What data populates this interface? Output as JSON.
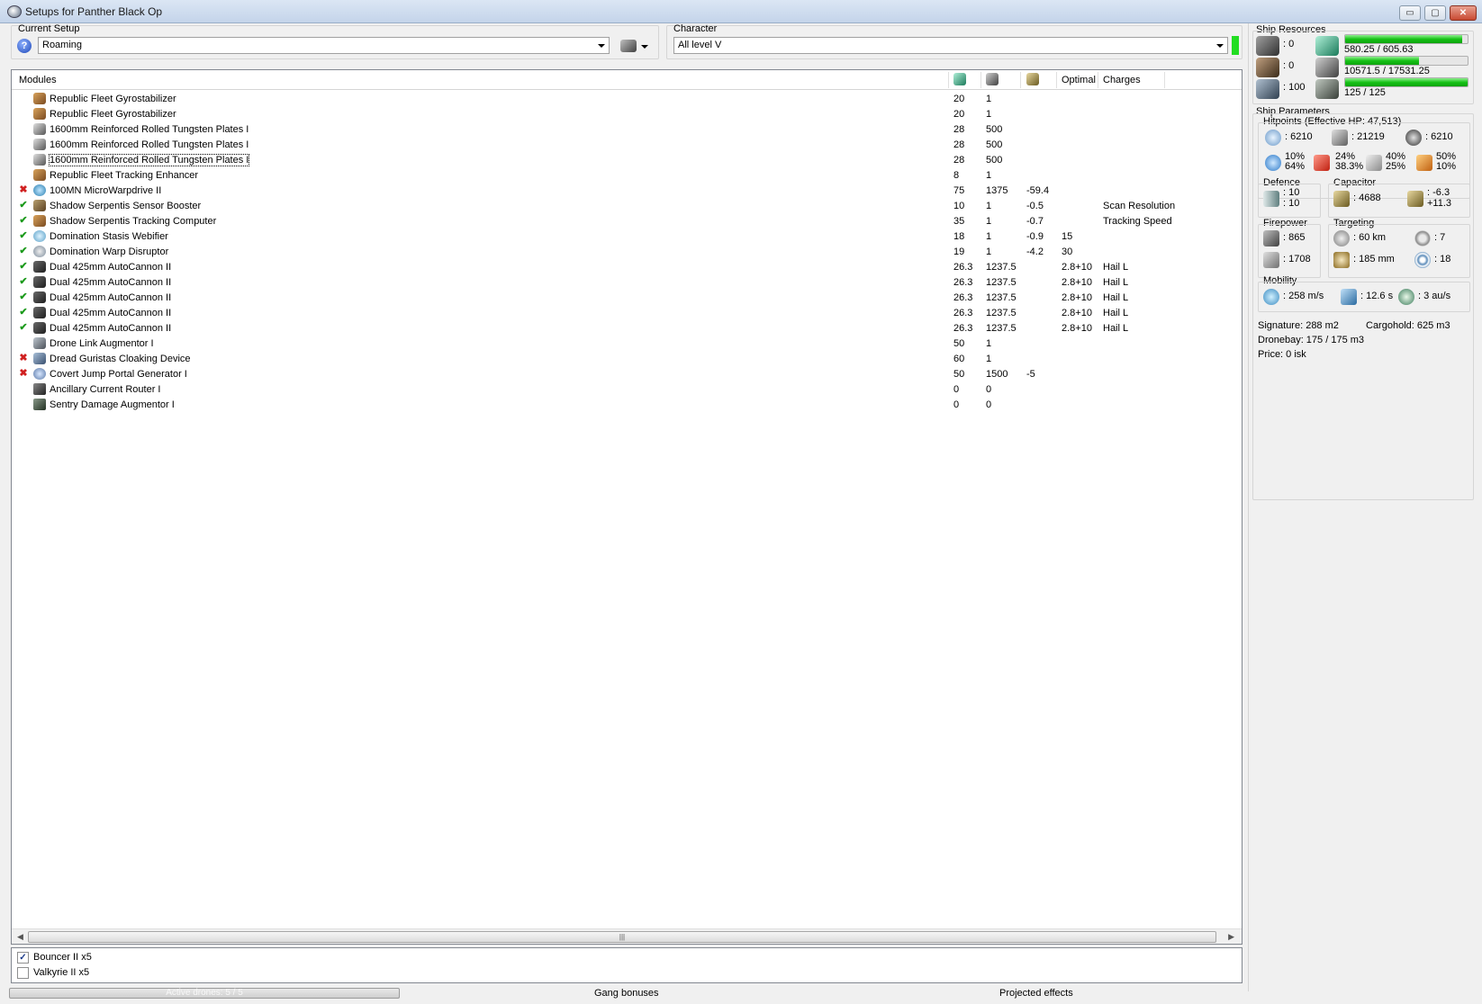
{
  "window": {
    "title": "Setups for Panther Black Op",
    "min_label": "▭",
    "max_label": "▢",
    "close_label": "✕"
  },
  "setup": {
    "label": "Current Setup",
    "value": "Roaming"
  },
  "character": {
    "label": "Character",
    "value": "All level V"
  },
  "grid": {
    "headers": {
      "modules": "Modules",
      "optimal": "Optimal",
      "charges": "Charges"
    },
    "rows": [
      {
        "mark": "",
        "icon": "gyro",
        "name": "Republic Fleet Gyrostabilizer",
        "cpu": "20",
        "pg": "1",
        "cap": "",
        "optimal": "",
        "charges": ""
      },
      {
        "mark": "",
        "icon": "gyro",
        "name": "Republic Fleet Gyrostabilizer",
        "cpu": "20",
        "pg": "1",
        "cap": "",
        "optimal": "",
        "charges": ""
      },
      {
        "mark": "",
        "icon": "plate",
        "name": "1600mm Reinforced Rolled Tungsten Plates I",
        "cpu": "28",
        "pg": "500",
        "cap": "",
        "optimal": "",
        "charges": ""
      },
      {
        "mark": "",
        "icon": "plate",
        "name": "1600mm Reinforced Rolled Tungsten Plates I",
        "cpu": "28",
        "pg": "500",
        "cap": "",
        "optimal": "",
        "charges": ""
      },
      {
        "mark": "",
        "icon": "plate",
        "name": "1600mm Reinforced Rolled Tungsten Plates I",
        "cpu": "28",
        "pg": "500",
        "cap": "",
        "optimal": "",
        "charges": ""
      },
      {
        "mark": "",
        "icon": "gyro",
        "name": "Republic Fleet Tracking Enhancer",
        "cpu": "8",
        "pg": "1",
        "cap": "",
        "optimal": "",
        "charges": ""
      },
      {
        "mark": "✖",
        "icon": "mwd",
        "name": "100MN MicroWarpdrive II",
        "cpu": "75",
        "pg": "1375",
        "cap": "-59.4",
        "optimal": "",
        "charges": ""
      },
      {
        "mark": "✔",
        "icon": "booster",
        "name": "Shadow Serpentis Sensor Booster",
        "cpu": "10",
        "pg": "1",
        "cap": "-0.5",
        "optimal": "",
        "charges": "Scan Resolution"
      },
      {
        "mark": "✔",
        "icon": "gyro",
        "name": "Shadow Serpentis Tracking Computer",
        "cpu": "35",
        "pg": "1",
        "cap": "-0.7",
        "optimal": "",
        "charges": "Tracking Speed"
      },
      {
        "mark": "✔",
        "icon": "web",
        "name": "Domination Stasis Webifier",
        "cpu": "18",
        "pg": "1",
        "cap": "-0.9",
        "optimal": "15",
        "charges": ""
      },
      {
        "mark": "✔",
        "icon": "disruptor",
        "name": "Domination Warp Disruptor",
        "cpu": "19",
        "pg": "1",
        "cap": "-4.2",
        "optimal": "30",
        "charges": ""
      },
      {
        "mark": "✔",
        "icon": "cannon",
        "name": "Dual 425mm AutoCannon II",
        "cpu": "26.3",
        "pg": "1237.5",
        "cap": "",
        "optimal": "2.8+10",
        "charges": "Hail L"
      },
      {
        "mark": "✔",
        "icon": "cannon",
        "name": "Dual 425mm AutoCannon II",
        "cpu": "26.3",
        "pg": "1237.5",
        "cap": "",
        "optimal": "2.8+10",
        "charges": "Hail L"
      },
      {
        "mark": "✔",
        "icon": "cannon",
        "name": "Dual 425mm AutoCannon II",
        "cpu": "26.3",
        "pg": "1237.5",
        "cap": "",
        "optimal": "2.8+10",
        "charges": "Hail L"
      },
      {
        "mark": "✔",
        "icon": "cannon",
        "name": "Dual 425mm AutoCannon II",
        "cpu": "26.3",
        "pg": "1237.5",
        "cap": "",
        "optimal": "2.8+10",
        "charges": "Hail L"
      },
      {
        "mark": "✔",
        "icon": "cannon",
        "name": "Dual 425mm AutoCannon II",
        "cpu": "26.3",
        "pg": "1237.5",
        "cap": "",
        "optimal": "2.8+10",
        "charges": "Hail L"
      },
      {
        "mark": "",
        "icon": "drone-link",
        "name": "Drone Link Augmentor I",
        "cpu": "50",
        "pg": "1",
        "cap": "",
        "optimal": "",
        "charges": ""
      },
      {
        "mark": "✖",
        "icon": "cloak",
        "name": "Dread Guristas Cloaking Device",
        "cpu": "60",
        "pg": "1",
        "cap": "",
        "optimal": "",
        "charges": ""
      },
      {
        "mark": "✖",
        "icon": "portal",
        "name": "Covert Jump Portal Generator I",
        "cpu": "50",
        "pg": "1500",
        "cap": "-5",
        "optimal": "",
        "charges": ""
      },
      {
        "mark": "",
        "icon": "rig1",
        "name": "Ancillary Current Router I",
        "cpu": "0",
        "pg": "0",
        "cap": "",
        "optimal": "",
        "charges": ""
      },
      {
        "mark": "",
        "icon": "rig2",
        "name": "Sentry Damage Augmentor I",
        "cpu": "0",
        "pg": "0",
        "cap": "",
        "optimal": "",
        "charges": ""
      }
    ]
  },
  "drones": [
    {
      "label": "Bouncer II x5",
      "checked": true,
      "check_glyph": "✓"
    },
    {
      "label": "Valkyrie II x5",
      "checked": false,
      "check_glyph": ""
    }
  ],
  "statusbar": {
    "active_drones": "Active drones: 5 / 5",
    "gang": "Gang bonuses",
    "projected": "Projected effects"
  },
  "resources": {
    "title": "Ship Resources",
    "turrets": ": 0",
    "launchers": ": 0",
    "calibration": ": 100",
    "cpu": {
      "text": "580.25 / 605.63",
      "fraction": 0.958
    },
    "powergrid": {
      "text": "10571.5 / 17531.25",
      "fraction": 0.603
    },
    "dronebandwidth": {
      "text": "125 / 125",
      "fraction": 1.0
    }
  },
  "params": {
    "title": "Ship Parameters",
    "hitpoints_title": "Hitpoints (Effective HP: 47,513)",
    "shield_hp": ": 6210",
    "armor_hp": ": 21219",
    "hull_hp": ": 6210",
    "em": {
      "a": "10%",
      "b": "64%"
    },
    "thermal": {
      "a": "24%",
      "b": "38.3%"
    },
    "kinetic": {
      "a": "40%",
      "b": "25%"
    },
    "explosive": {
      "a": "50%",
      "b": "10%"
    },
    "defence_title": "Defence",
    "defence_a": ": 10",
    "defence_b": ": 10",
    "capacitor_title": "Capacitor",
    "capacitor_amount": ": 4688",
    "capacitor_a": ": -6.3",
    "capacitor_b": "+11.3",
    "firepower_title": "Firepower",
    "fire_a": ": 865",
    "fire_b": ": 1708",
    "targeting_title": "Targeting",
    "range": ": 60 km",
    "scanres": ": 185 mm",
    "max_targets": ": 7",
    "sensor": ": 18",
    "mobility_title": "Mobility",
    "velocity": ": 258 m/s",
    "align": ": 12.6 s",
    "warp": ": 3 au/s",
    "signature": "Signature: 288 m2",
    "cargohold": "Cargohold: 625 m3",
    "dronebay": "Dronebay: 175 / 175 m3",
    "price": "Price: 0 isk"
  }
}
